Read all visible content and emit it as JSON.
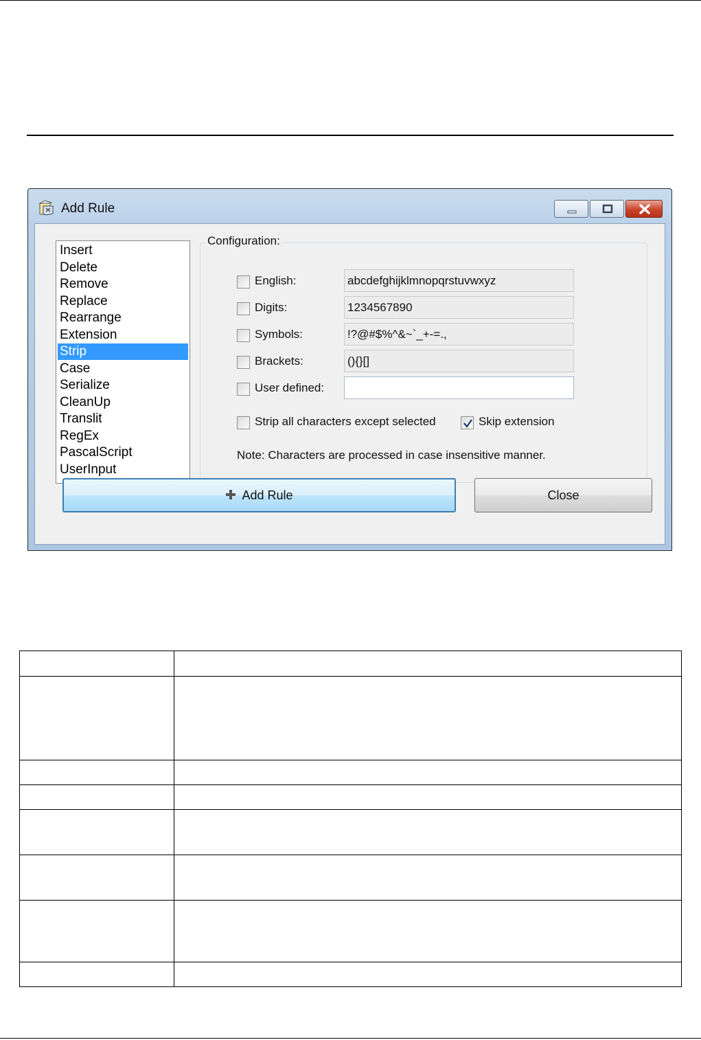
{
  "dialog": {
    "title": "Add Rule",
    "rules": [
      "Insert",
      "Delete",
      "Remove",
      "Replace",
      "Rearrange",
      "Extension",
      "Strip",
      "Case",
      "Serialize",
      "CleanUp",
      "Translit",
      "RegEx",
      "PascalScript",
      "UserInput"
    ],
    "selected_rule": "Strip",
    "configuration": {
      "legend": "Configuration:",
      "rows": [
        {
          "label": "English:",
          "value": "abcdefghijklmnopqrstuvwxyz",
          "checked": false
        },
        {
          "label": "Digits:",
          "value": "1234567890",
          "checked": false
        },
        {
          "label": "Symbols:",
          "value": "!?@#$%^&~`_+-=.,",
          "checked": false
        },
        {
          "label": "Brackets:",
          "value": "(){}[]",
          "checked": false
        },
        {
          "label": "User defined:",
          "value": "",
          "checked": false
        }
      ],
      "strip_all_except": {
        "label": "Strip all characters except selected",
        "checked": false
      },
      "skip_extension": {
        "label": "Skip extension",
        "checked": true
      },
      "note": "Note: Characters are processed in case insensitive manner."
    },
    "buttons": {
      "add_rule": "Add Rule",
      "close": "Close"
    }
  },
  "colors": {
    "selection": "#3399ff",
    "title_bar": "#b9d0e8",
    "add_button_border": "#3c7fb1"
  }
}
